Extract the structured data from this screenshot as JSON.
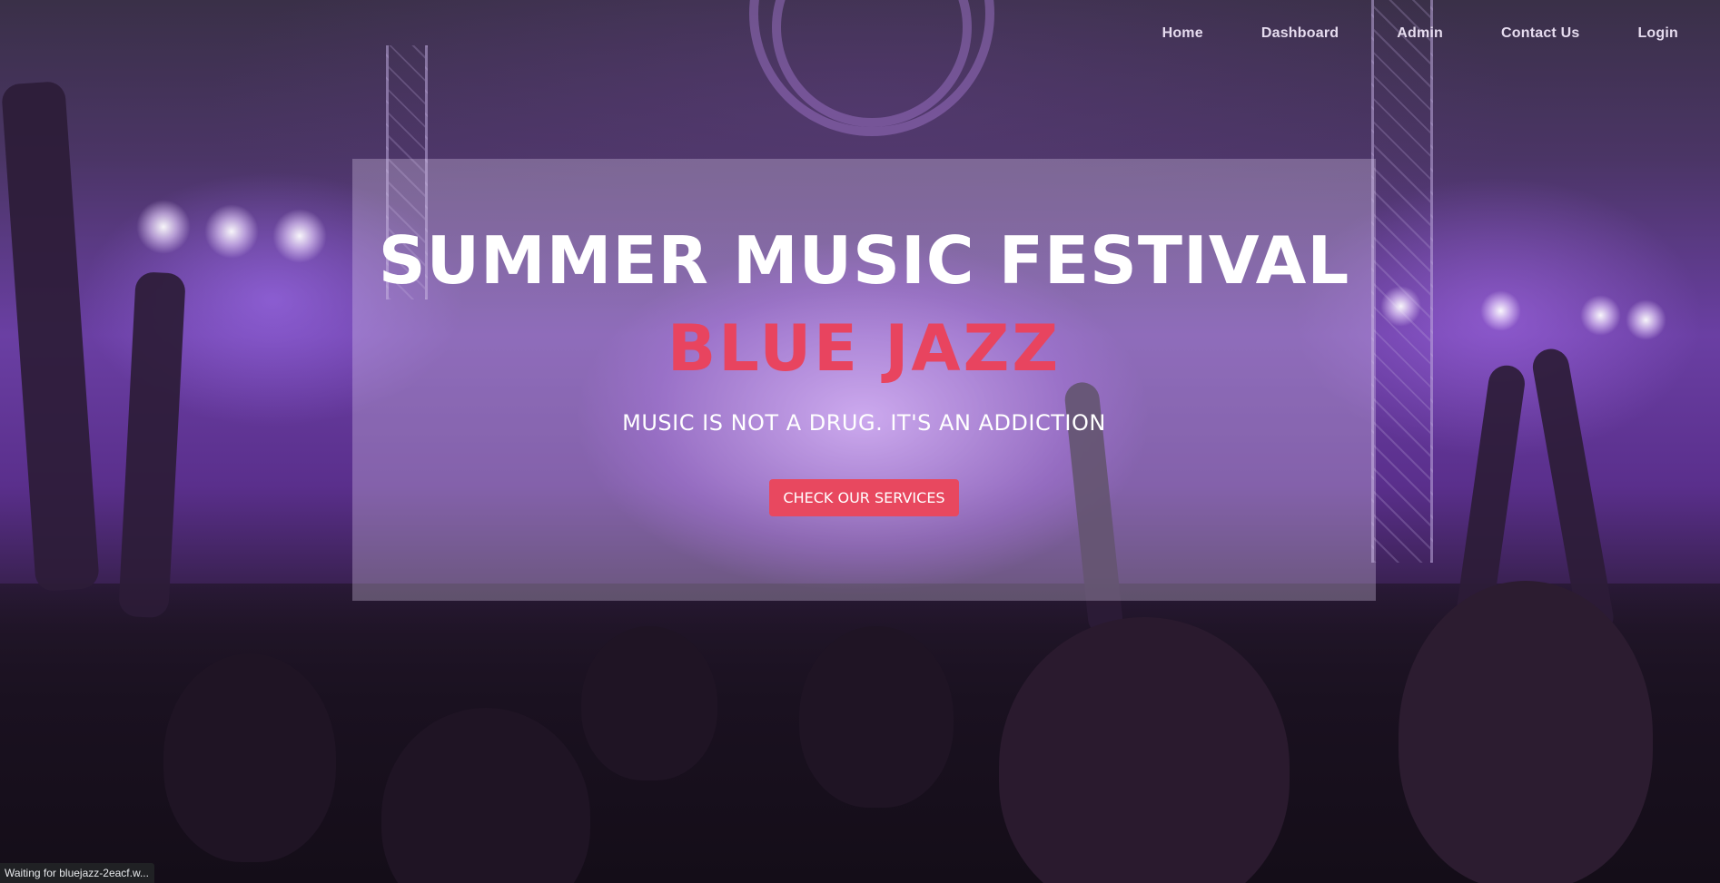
{
  "nav": {
    "items": [
      {
        "label": "Home"
      },
      {
        "label": "Dashboard"
      },
      {
        "label": "Admin"
      },
      {
        "label": "Contact Us"
      },
      {
        "label": "Login"
      }
    ]
  },
  "hero": {
    "title": "SUMMER MUSIC FESTIVAL",
    "subtitle": "BLUE JAZZ",
    "tagline": "MUSIC IS NOT A DRUG. IT'S AN ADDICTION",
    "cta_label": "CHECK OUR SERVICES"
  },
  "status_bar": {
    "text": "Waiting for bluejazz-2eacf.w..."
  },
  "colors": {
    "accent": "#e8445f",
    "overlay": "rgba(220,205,235,0.32)",
    "status_bar_bg": "#202124"
  },
  "icons": {
    "background": "concert-crowd-background"
  }
}
